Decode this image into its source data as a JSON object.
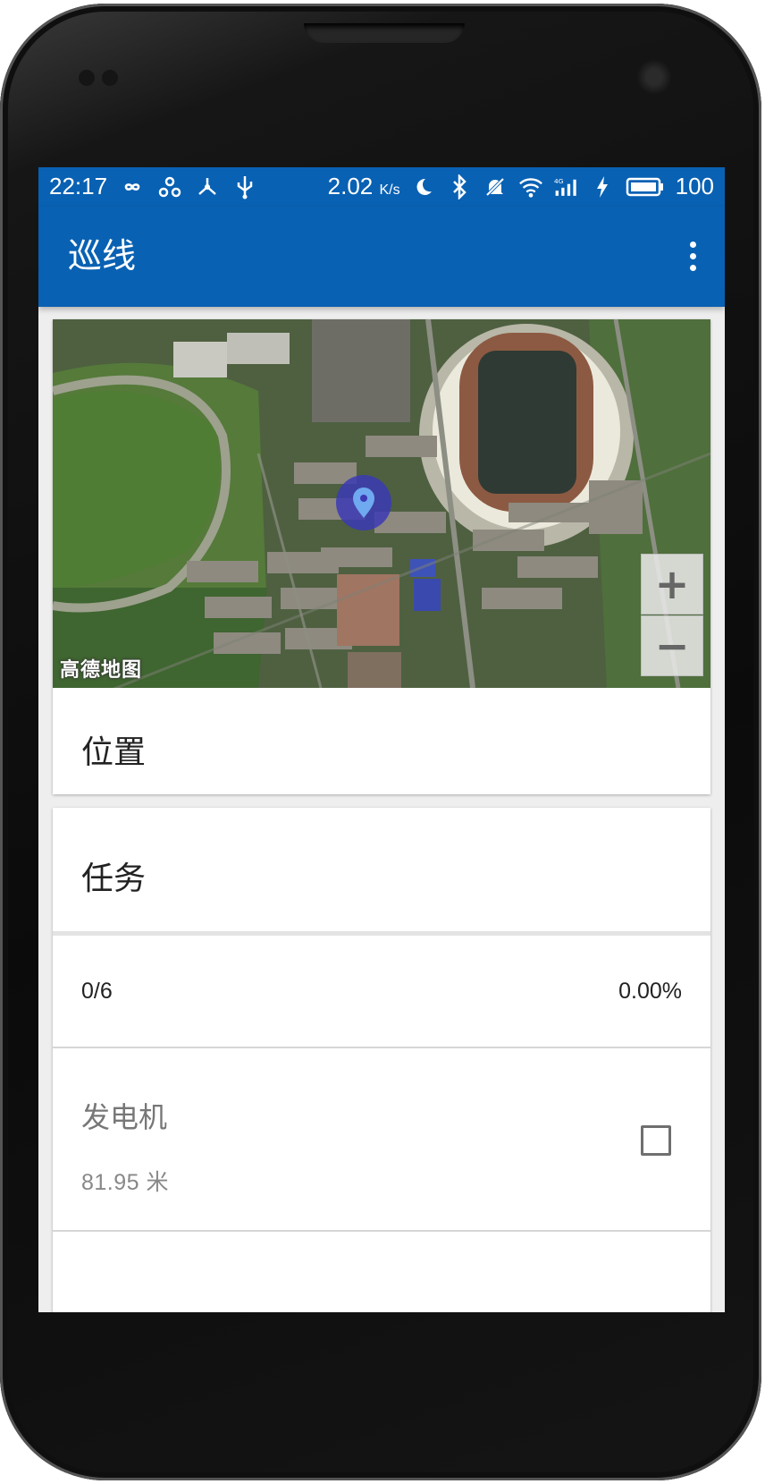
{
  "status_bar": {
    "time": "22:17",
    "speed": "2.02",
    "speed_unit": "K/s",
    "battery": "100",
    "icons_left": [
      "infinity-icon",
      "share-icon",
      "network-icon",
      "usb-icon"
    ],
    "icons_right": [
      "night-mode-icon",
      "bluetooth-icon",
      "muted-bell-icon",
      "wifi-icon",
      "signal-4g-icon",
      "charging-icon",
      "battery-icon"
    ]
  },
  "app_bar": {
    "title": "巡线",
    "menu_icon": "more-vert-icon"
  },
  "location_card": {
    "map_attribution": "高德地图",
    "zoom_in": "+",
    "zoom_out": "−",
    "label": "位置"
  },
  "task_card": {
    "title": "任务",
    "progress_count": "0/6",
    "progress_percent": "0.00%",
    "items": [
      {
        "name": "发电机",
        "distance": "81.95 米",
        "checked": false
      }
    ]
  },
  "colors": {
    "primary": "#0961b3",
    "background": "#eeeeee",
    "card": "#ffffff",
    "location_marker": "#3c3ab4"
  }
}
